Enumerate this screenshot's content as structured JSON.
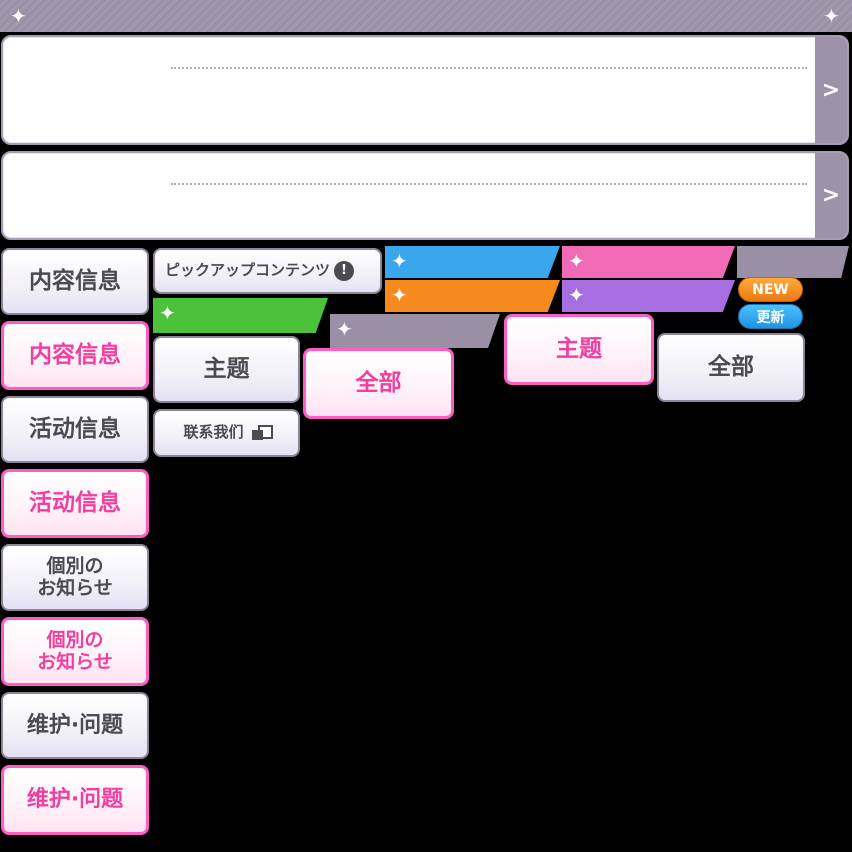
{
  "pickup": {
    "label": "ピックアップコンテンツ",
    "alert_icon": "!"
  },
  "panels": {
    "arrow": ">"
  },
  "sidebar": {
    "items": [
      {
        "label": "内容信息"
      },
      {
        "label": "内容信息"
      },
      {
        "label": "活动信息"
      },
      {
        "label": "活动信息"
      },
      {
        "label": "個別の\nお知らせ"
      },
      {
        "label": "個別の\nお知らせ"
      },
      {
        "label": "维护·问题"
      },
      {
        "label": "维护·问题"
      }
    ]
  },
  "filters": {
    "theme": "主题",
    "all": "全部",
    "theme_active": "主题",
    "all_normal": "全部",
    "all_active": "全部",
    "contact": "联系我们"
  },
  "badges": {
    "new": "NEW",
    "update": "更新"
  },
  "colors": {
    "accent_pink": "#ff5cc6",
    "ribbon_blue": "#3aa6ee",
    "ribbon_pink": "#f16ab5",
    "ribbon_orange": "#f78a1e",
    "ribbon_purple": "#a66ee0",
    "ribbon_green": "#4bc23a",
    "ribbon_gray": "#9b8fa6"
  }
}
